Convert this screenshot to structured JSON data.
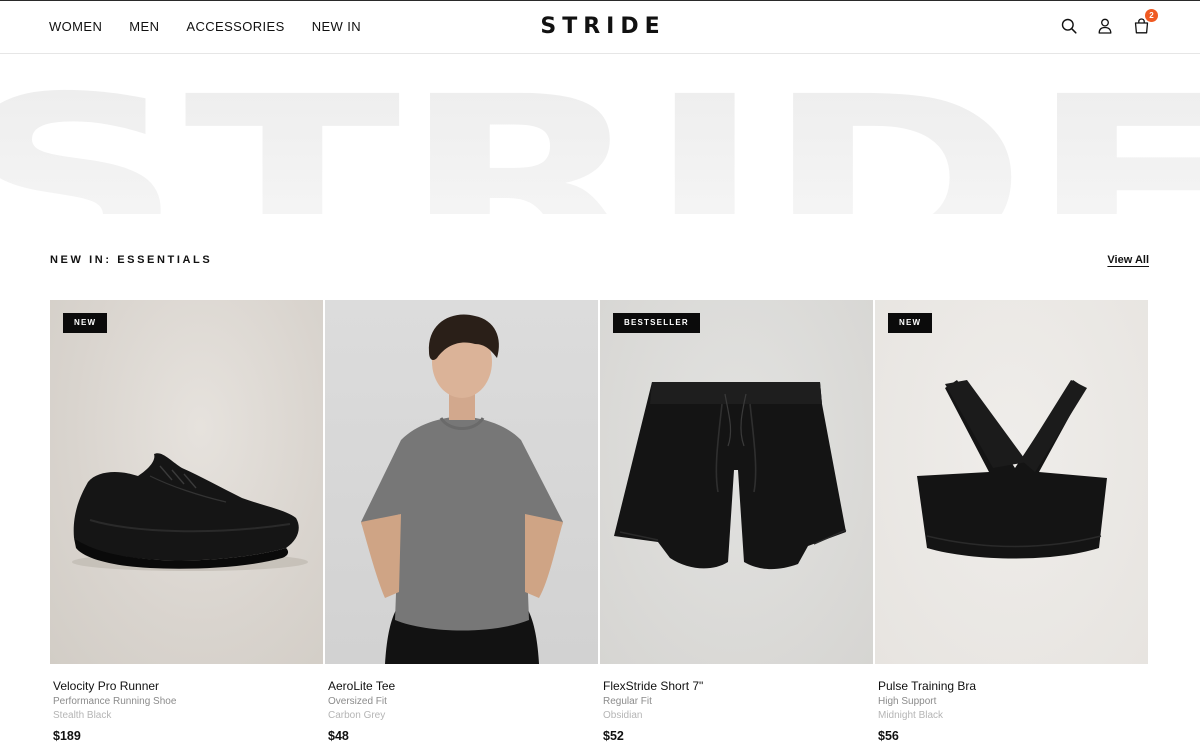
{
  "header": {
    "nav": [
      "WOMEN",
      "MEN",
      "ACCESSORIES",
      "NEW IN"
    ],
    "logo": "STRIDE",
    "cart_count": "2"
  },
  "hero": {
    "watermark": "STRIDE"
  },
  "section": {
    "title": "NEW IN: ESSENTIALS",
    "view_all": "View All"
  },
  "products": [
    {
      "tag": "NEW",
      "name": "Velocity Pro Runner",
      "subtitle": "Performance Running Shoe",
      "color": "Stealth Black",
      "price": "$189"
    },
    {
      "tag": "",
      "name": "AeroLite Tee",
      "subtitle": "Oversized Fit",
      "color": "Carbon Grey",
      "price": "$48"
    },
    {
      "tag": "BESTSELLER",
      "name": "FlexStride Short 7\"",
      "subtitle": "Regular Fit",
      "color": "Obsidian",
      "price": "$52"
    },
    {
      "tag": "NEW",
      "name": "Pulse Training Bra",
      "subtitle": "High Support",
      "color": "Midnight Black",
      "price": "$56"
    }
  ],
  "colors": {
    "accent": "#f05a22",
    "text": "#111111",
    "muted": "#8b8b8b",
    "tag_bg": "#0b0b0b"
  },
  "icons": [
    "search-icon",
    "account-icon",
    "cart-icon"
  ]
}
